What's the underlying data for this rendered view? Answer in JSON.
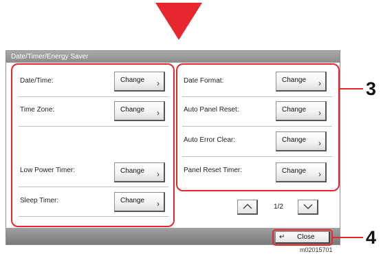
{
  "window": {
    "title": "Date/Timer/Energy Saver"
  },
  "settings": [
    {
      "label": "Date/Time:",
      "button": "Change"
    },
    {
      "label": "Date Format:",
      "button": "Change"
    },
    {
      "label": "Time Zone:",
      "button": "Change"
    },
    {
      "label": "Auto Panel Reset:",
      "button": "Change"
    },
    {
      "label": "Auto Error Clear:",
      "button": "Change"
    },
    {
      "label": "Low Power Timer:",
      "button": "Change"
    },
    {
      "label": "Panel Reset Timer:",
      "button": "Change"
    },
    {
      "label": "Sleep Timer:",
      "button": "Change"
    }
  ],
  "pagination": {
    "indicator": "1/2"
  },
  "footer": {
    "close_label": "Close"
  },
  "callouts": {
    "settings": "3",
    "close": "4"
  },
  "image_code": "m02015701",
  "colors": {
    "highlight": "#e8262d",
    "titlebar": "#9a9a9a"
  }
}
